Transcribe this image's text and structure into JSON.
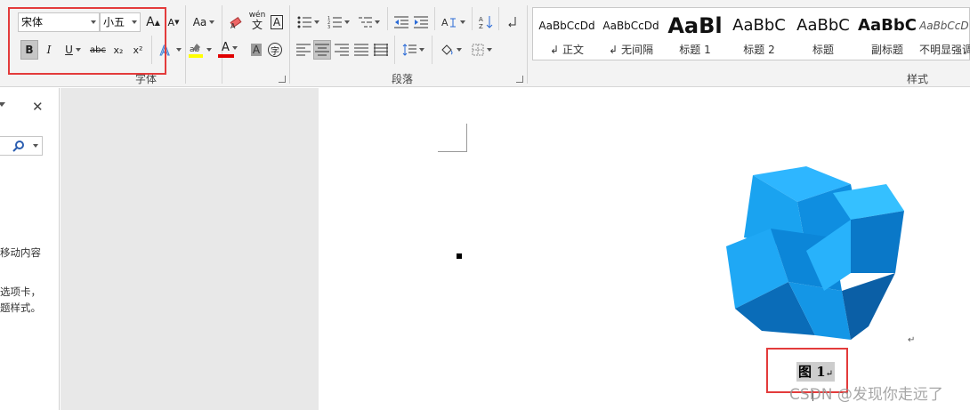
{
  "font": {
    "family_value": "宋体",
    "size_value": "小五",
    "group_label": "字体",
    "buttons": {
      "bold": "B",
      "italic": "I",
      "underline": "U",
      "strike": "abc",
      "subscript": "x₂",
      "superscript": "x²",
      "change_case": "Aa",
      "phonetic_top": "wén",
      "phonetic_bottom": "文",
      "char_border": "A",
      "font_color": "A",
      "char_shading": "A",
      "enclose": "字",
      "grow": "A",
      "shrink": "A"
    }
  },
  "paragraph": {
    "group_label": "段落"
  },
  "styles": {
    "group_label": "样式",
    "items": [
      {
        "sample": "AaBbCcDd",
        "name": "正文",
        "mark": "↲"
      },
      {
        "sample": "AaBbCcDd",
        "name": "无间隔",
        "mark": "↲"
      },
      {
        "sample": "AaBl",
        "name": "标题 1"
      },
      {
        "sample": "AaBbC",
        "name": "标题 2"
      },
      {
        "sample": "AaBbC",
        "name": "标题"
      },
      {
        "sample": "AaBbC",
        "name": "副标题"
      },
      {
        "sample": "AaBbCcD",
        "name": "不明显强调"
      }
    ]
  },
  "nav": {
    "close": "✕",
    "text1": "移动内容",
    "text2": "选项卡，",
    "text3": "题样式。"
  },
  "doc": {
    "caption": "图 1",
    "para_mark": "↵"
  },
  "watermark": "CSDN @发现你走远了",
  "colors": {
    "red_box": "#e33b3b",
    "font_red": "#e00000",
    "highlight_yellow": "#ffff00",
    "cube_blue": "#1aa3f0"
  }
}
